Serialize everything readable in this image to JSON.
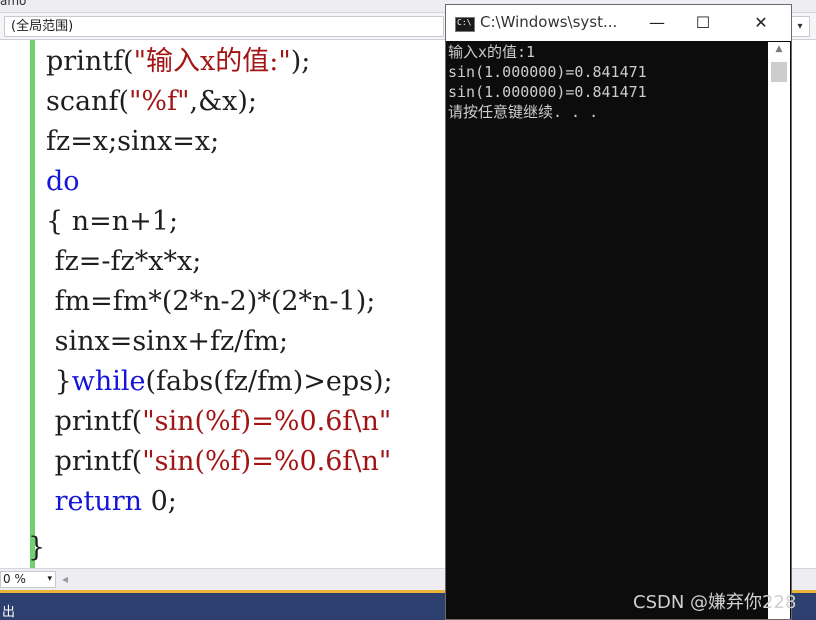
{
  "top_strip": {
    "title_fragment": "amo"
  },
  "scope_bar": {
    "scope_label": "(全局范围)",
    "arrow": "▾"
  },
  "code_lines": [
    {
      "segs": [
        {
          "t": "printf(",
          "c": ""
        },
        {
          "t": "\"输入x的值:\"",
          "c": "str"
        },
        {
          "t": ");",
          "c": ""
        }
      ]
    },
    {
      "segs": [
        {
          "t": "scanf(",
          "c": ""
        },
        {
          "t": "\"%f\"",
          "c": "str"
        },
        {
          "t": ",&x);",
          "c": ""
        }
      ]
    },
    {
      "segs": [
        {
          "t": "fz=x;sinx=x;",
          "c": ""
        }
      ]
    },
    {
      "segs": [
        {
          "t": "do",
          "c": "kw"
        }
      ]
    },
    {
      "segs": [
        {
          "t": "{ n=n+1;",
          "c": ""
        }
      ]
    },
    {
      "segs": [
        {
          "t": " fz=-fz*x*x;",
          "c": ""
        }
      ]
    },
    {
      "segs": [
        {
          "t": " fm=fm*(2*n-2)*(2*n-1);",
          "c": ""
        }
      ]
    },
    {
      "segs": [
        {
          "t": " sinx=sinx+fz/fm;",
          "c": ""
        }
      ]
    },
    {
      "segs": [
        {
          "t": " }",
          "c": ""
        },
        {
          "t": "while",
          "c": "kw"
        },
        {
          "t": "(fabs(fz/fm)>eps);",
          "c": ""
        }
      ]
    },
    {
      "segs": [
        {
          "t": " printf(",
          "c": ""
        },
        {
          "t": "\"sin(%f)=%0.6f\\n\"",
          "c": "str"
        }
      ]
    },
    {
      "segs": [
        {
          "t": " printf(",
          "c": ""
        },
        {
          "t": "\"sin(%f)=%0.6f\\n\"",
          "c": "str"
        }
      ]
    },
    {
      "segs": [
        {
          "t": " ",
          "c": ""
        },
        {
          "t": "return",
          "c": "kw"
        },
        {
          "t": " 0;",
          "c": ""
        }
      ]
    }
  ],
  "closing_brace": "}",
  "zoom_bar": {
    "zoom_value": "0 %",
    "zoom_arrow": "▾",
    "scroll_left": "◂"
  },
  "output_tab": {
    "label": "出"
  },
  "console": {
    "title": "C:\\Windows\\syst...",
    "icon_text": "C:\\",
    "minimize": "—",
    "maximize": "☐",
    "close": "✕",
    "output_lines": [
      "输入x的值:1",
      "sin(1.000000)=0.841471",
      "sin(1.000000)=0.841471",
      "请按任意键继续. . ."
    ],
    "scroll_up": "▲"
  },
  "watermark": "CSDN @嫌弃你228"
}
